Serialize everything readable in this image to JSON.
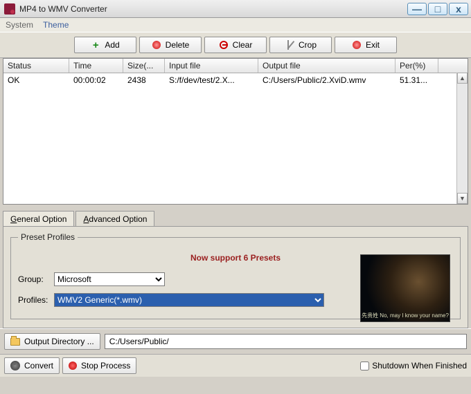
{
  "titlebar": {
    "title": "MP4 to WMV Converter"
  },
  "menu": {
    "system": "System",
    "theme": "Theme"
  },
  "toolbar": {
    "add": "Add",
    "delete": "Delete",
    "clear": "Clear",
    "crop": "Crop",
    "exit": "Exit"
  },
  "table": {
    "headers": {
      "status": "Status",
      "time": "Time",
      "size": "Size(...",
      "input": "Input file",
      "output": "Output file",
      "per": "Per(%)"
    },
    "rows": [
      {
        "status": "OK",
        "time": "00:00:02",
        "size": "2438",
        "input": "S:/f/dev/test/2.X...",
        "output": "C:/Users/Public/2.XviD.wmv",
        "per": "51.31..."
      }
    ]
  },
  "tabs": {
    "general": "General Option",
    "advanced": "Advanced Option"
  },
  "presets": {
    "legend": "Preset Profiles",
    "message": "Now support 6 Presets",
    "group_label": "Group:",
    "group_value": "Microsoft",
    "profiles_label": "Profiles:",
    "profiles_value": "WMV2 Generic(*.wmv)",
    "preview_subtitle": "先贵姓\nNo, may I know your name?"
  },
  "output": {
    "button": "Output Directory ...",
    "path": "C:/Users/Public/"
  },
  "bottom": {
    "convert": "Convert",
    "stop": "Stop Process",
    "shutdown": "Shutdown When Finished"
  }
}
